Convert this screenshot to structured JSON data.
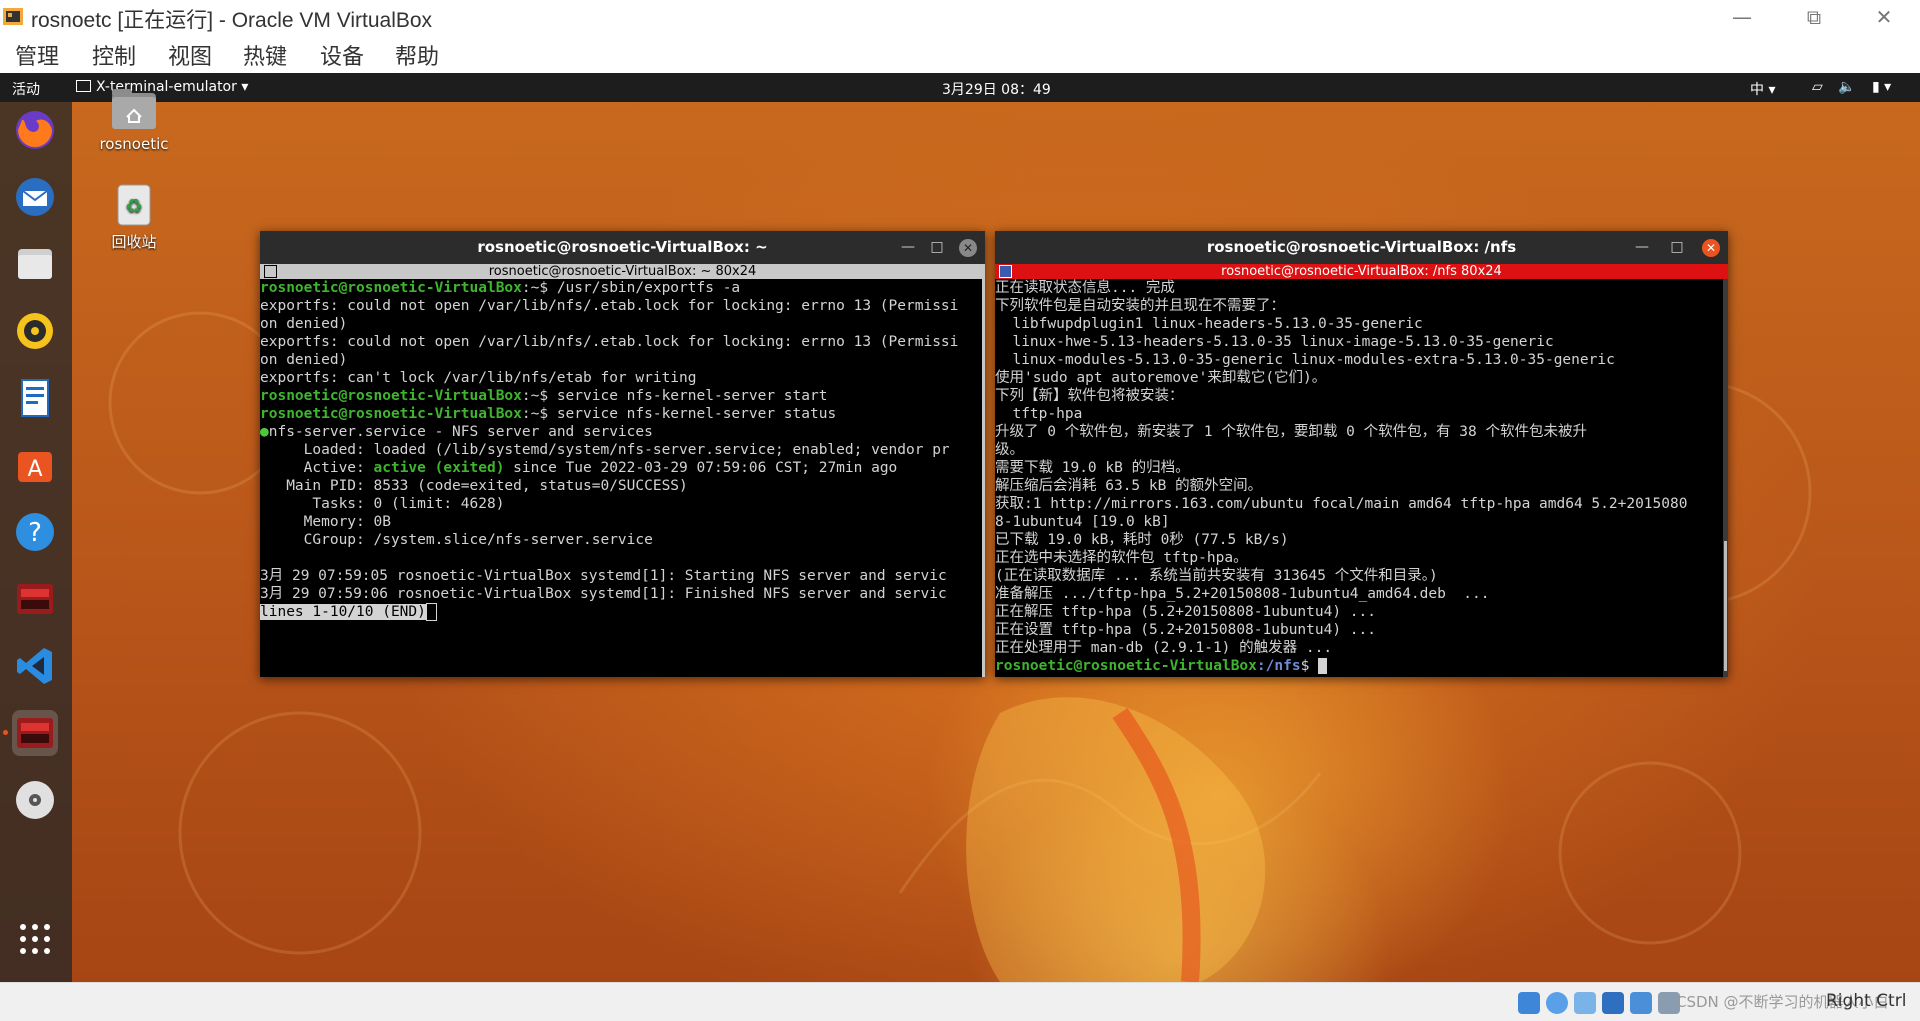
{
  "host": {
    "title": "rosnoetc [正在运行] - Oracle VM VirtualBox",
    "menu": [
      "管理",
      "控制",
      "视图",
      "热键",
      "设备",
      "帮助"
    ],
    "status_text": "Right Ctrl",
    "status_watermark": "CSDN @不断学习的机器人小白"
  },
  "topbar": {
    "activities": "活动",
    "app": "X-terminal-emulator ▾",
    "clock": "3月29日  08：49",
    "ime": "中 ▾"
  },
  "desktop": {
    "icons": [
      {
        "label": "rosnoetic"
      },
      {
        "label": "回收站"
      }
    ]
  },
  "dock": [
    {
      "icon": "firefox-icon"
    },
    {
      "icon": "thunderbird-icon"
    },
    {
      "icon": "files-icon"
    },
    {
      "icon": "rhythmbox-icon"
    },
    {
      "icon": "writer-icon"
    },
    {
      "icon": "software-icon"
    },
    {
      "icon": "help-icon"
    },
    {
      "icon": "terminal-icon"
    },
    {
      "icon": "vscode-icon"
    },
    {
      "icon": "terminal-active-icon"
    },
    {
      "icon": "dvd-icon"
    },
    {
      "icon": "app-grid-icon"
    }
  ],
  "term_left": {
    "title": "rosnoetic@rosnoetic-VirtualBox: ~",
    "subtitle": "rosnoetic@rosnoetic-VirtualBox: ~ 80x24",
    "prompt_user": "rosnoetic@rosnoetic-VirtualBox",
    "lines": {
      "l1_cmd": ":~$ /usr/sbin/exportfs -a",
      "l2": "exportfs: could not open /var/lib/nfs/.etab.lock for locking: errno 13 (Permissi",
      "l3": "on denied)",
      "l4": "exportfs: could not open /var/lib/nfs/.etab.lock for locking: errno 13 (Permissi",
      "l5": "on denied)",
      "l6": "exportfs: can't lock /var/lib/nfs/etab for writing",
      "l7_cmd": ":~$ service nfs-kernel-server start",
      "l8_cmd": ":~$ service nfs-kernel-server status",
      "l9": "nfs-server.service - NFS server and services",
      "l10": "     Loaded: loaded (/lib/systemd/system/nfs-server.service; enabled; vendor pr",
      "l11a": "     Active: ",
      "l11b": "active (exited)",
      "l11c": " since Tue 2022-03-29 07:59:06 CST; 27min ago",
      "l12": "   Main PID: 8533 (code=exited, status=0/SUCCESS)",
      "l13": "      Tasks: 0 (limit: 4628)",
      "l14": "     Memory: 0B",
      "l15": "     CGroup: /system.slice/nfs-server.service",
      "l16": "",
      "l17": "3月 29 07:59:05 rosnoetic-VirtualBox systemd[1]: Starting NFS server and servic",
      "l18": "3月 29 07:59:06 rosnoetic-VirtualBox systemd[1]: Finished NFS server and servic",
      "l19": "lines 1-10/10 (END)"
    }
  },
  "term_right": {
    "title": "rosnoetic@rosnoetic-VirtualBox: /nfs",
    "subtitle": "rosnoetic@rosnoetic-VirtualBox: /nfs 80x24",
    "lines": {
      "r1": "正在读取状态信息... 完成",
      "r2": "下列软件包是自动安装的并且现在不需要了：",
      "r3": "  libfwupdplugin1 linux-headers-5.13.0-35-generic",
      "r4": "  linux-hwe-5.13-headers-5.13.0-35 linux-image-5.13.0-35-generic",
      "r5": "  linux-modules-5.13.0-35-generic linux-modules-extra-5.13.0-35-generic",
      "r6": "使用'sudo apt autoremove'来卸载它(它们)。",
      "r7": "下列【新】软件包将被安装：",
      "r8": "  tftp-hpa",
      "r9": "升级了 0 个软件包，新安装了 1 个软件包，要卸载 0 个软件包，有 38 个软件包未被升",
      "r10": "级。",
      "r11": "需要下载 19.0 kB 的归档。",
      "r12": "解压缩后会消耗 63.5 kB 的额外空间。",
      "r13": "获取:1 http://mirrors.163.com/ubuntu focal/main amd64 tftp-hpa amd64 5.2+2015080",
      "r14": "8-1ubuntu4 [19.0 kB]",
      "r15": "已下载 19.0 kB，耗时 0秒 (77.5 kB/s)",
      "r16": "正在选中未选择的软件包 tftp-hpa。",
      "r17": "(正在读取数据库 ... 系统当前共安装有 313645 个文件和目录。)",
      "r18": "准备解压 .../tftp-hpa_5.2+20150808-1ubuntu4_amd64.deb  ...",
      "r19": "正在解压 tftp-hpa (5.2+20150808-1ubuntu4) ...",
      "r20": "正在设置 tftp-hpa (5.2+20150808-1ubuntu4) ...",
      "r21": "正在处理用于 man-db (2.9.1-1) 的触发器 ...",
      "r22_user": "rosnoetic@rosnoetic-VirtualBox",
      "r22_path": ":/nfs",
      "r22_tail": "$ "
    }
  },
  "colors": {
    "ubuntu_orange": "#e95420",
    "prompt_green": "#3fb52f",
    "path_blue": "#6f8bd6",
    "right_sub_red": "#dd1111"
  }
}
